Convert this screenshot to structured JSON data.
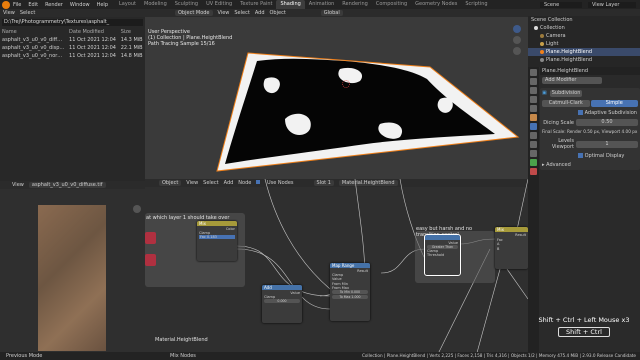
{
  "topbar": {
    "menus": [
      "File",
      "Edit",
      "Render",
      "Window",
      "Help"
    ],
    "workspaces": [
      "Layout",
      "Modeling",
      "Sculpting",
      "UV Editing",
      "Texture Paint",
      "Shading",
      "Animation",
      "Rendering",
      "Compositing",
      "Geometry Nodes",
      "Scripting"
    ],
    "active_workspace": "Shading",
    "scene": "Scene",
    "view_layer": "View Layer"
  },
  "file_browser": {
    "menus": [
      "View",
      "Select"
    ],
    "path": "D:\\Trej\\Photogrammetry\\Textures\\asphalt_",
    "columns": [
      "Name",
      "Date Modified",
      "Size"
    ],
    "files": [
      {
        "name": "asphalt_v3_u0_v0_diffuse.tif",
        "date": "11 Oct 2021 12:04",
        "size": "14.3 MiB"
      },
      {
        "name": "asphalt_v3_u0_v0_displacement.exr",
        "date": "11 Oct 2021 12:04",
        "size": "22.1 MiB"
      },
      {
        "name": "asphalt_v3_u0_v0_normal.tif",
        "date": "11 Oct 2021 12:04",
        "size": "14.8 MiB"
      }
    ]
  },
  "viewport": {
    "mode": "Object Mode",
    "menus": [
      "View",
      "Select",
      "Add",
      "Object"
    ],
    "global": "Global",
    "info": [
      "User Perspective",
      "(1) Collection | Plane.HeightBlend",
      "Path Tracing Sample 15/16"
    ]
  },
  "outliner": {
    "title": "Scene Collection",
    "items": [
      {
        "label": "Collection",
        "selected": false
      },
      {
        "label": "Camera",
        "selected": false
      },
      {
        "label": "Light",
        "selected": false
      },
      {
        "label": "Plane.HeightBlend",
        "selected": true
      },
      {
        "label": "Plane.HeightBlend",
        "selected": false
      }
    ]
  },
  "properties": {
    "object_name": "Plane.HeightBlend",
    "add_modifier": "Add Modifier",
    "modifier_type": "Subdivision",
    "modifier_name": "Subdivision",
    "catmull": "Catmull-Clark",
    "simple": "Simple",
    "adaptive": "Adaptive Subdivision",
    "dicing_label": "Dicing Scale",
    "dicing_value": "0.50",
    "final_scale": "Final Scale: Render 0.50 px, Viewport 4.00 px",
    "levels_label": "Levels Viewport",
    "levels_value": "1",
    "optimal": "Optimal Display",
    "advanced": "Advanced"
  },
  "image_editor": {
    "menus": [
      "View"
    ],
    "image_name": "asphalt_v3_u0_v0_diffuse.tif"
  },
  "node_editor": {
    "mode": "Object",
    "menus": [
      "View",
      "Select",
      "Add",
      "Node"
    ],
    "use_nodes": "Use Nodes",
    "slot": "Slot 1",
    "material": "Material.HeightBlend",
    "frame1_label": "at which layer 1 should take over",
    "frame2_label": "easy but harsh and no transition control",
    "bottom_label": "Material.HeightBlend",
    "nodes": {
      "mix": {
        "title": "Mix",
        "value": "0.183",
        "clamp": "Clamp",
        "color": "Color",
        "fac": "Fac"
      },
      "add": {
        "title": "Add",
        "clamp": "Clamp",
        "value": "Value",
        "v2": "0.000"
      },
      "map": {
        "title": "Map Range",
        "result": "Result",
        "clamp": "Clamp",
        "value": "Value",
        "from_min": "From Min",
        "from_max": "From Max",
        "to_min": "To Min",
        "to_max": "To Max",
        "to_min_val": "0.000",
        "to_max_val": "1.000"
      },
      "math": {
        "title": "Greater Than",
        "value": "Value",
        "clamp": "Clamp",
        "threshold": "Threshold"
      },
      "out": {
        "title": "Mix",
        "result": "Result",
        "fac": "Fac",
        "a": "A",
        "b": "B"
      }
    }
  },
  "keys": {
    "caption": "Shift + Ctrl + Left Mouse x3",
    "key": "Shift + Ctrl"
  },
  "status": {
    "left": "Previous Mode",
    "mid": "Mix Nodes",
    "right": "Collection | Plane.HeightBlend | Verts 2,225 | Faces 2,158 | Tris 4,316 | Objects 1/2 | Memory 475.4 MiB | 2.93.0 Release Candidate"
  },
  "colors": {
    "selection_orange": "#f0801a",
    "accent_blue": "#4772b3",
    "node_mix": "#a69a3a",
    "node_converter": "#4572a8"
  }
}
